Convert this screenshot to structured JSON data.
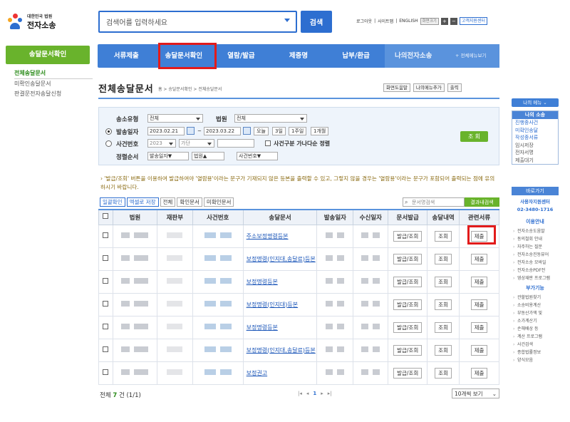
{
  "header": {
    "logo_line1": "대한민국 법원",
    "logo_line2": "전자소송",
    "search_placeholder": "검색어를 입력하세요",
    "search_button": "검색",
    "util": {
      "logout": "로그아웃",
      "sitemap": "사이트맵",
      "english": "ENGLISH",
      "font_size": "화면크기",
      "customer_center": "고객지원센터"
    }
  },
  "gnb": [
    "서류제출",
    "송달문서확인",
    "열람/발급",
    "제증명",
    "납부/환급",
    "나의전자소송",
    "+ 전체메뉴보기"
  ],
  "sidebar": {
    "title": "송달문서확인",
    "items": [
      "전체송달문서",
      "미확인송달문서",
      "판결문전자송달신청"
    ]
  },
  "page": {
    "title": "전체송달문서",
    "breadcrumb": "홈 > 송달문서확인 > 전체송달문서",
    "buttons": [
      "화면도움말",
      "나의메뉴추가",
      "출력"
    ]
  },
  "filter": {
    "send_type_label": "송소유형",
    "send_type_value": "전체",
    "court_label": "법원",
    "court_value": "전체",
    "date_label": "발송일자",
    "date_from": "2023.02.21",
    "date_to": "2023.03.22",
    "date_btns": [
      "오늘",
      "3일",
      "1주일",
      "1개월"
    ],
    "case_label": "사건번호",
    "case_year": "2023",
    "case_kind": "가단",
    "case_multi": "사건구분 가나다순 정렬",
    "sort_label": "정렬순서",
    "sort_values": [
      "발송일자▼",
      "법원▲",
      "사건번호▼"
    ],
    "query_button": "조 회"
  },
  "notice": "› '발급/조회' 버튼을 이용하여 발급하여야 '열람용'이라는 문구가 기재되지 않은 등본을 출력할 수 있고, 그렇지 않을 경우는 '열람용'이라는 문구가 포함되어 출력되는 점에 유의하시기 바랍니다.",
  "actions": [
    "일괄확인",
    "엑셀로 저장",
    "전체",
    "확인문서",
    "미확인문서"
  ],
  "result_search": {
    "placeholder": "문서명검색",
    "button": "결과내검색"
  },
  "table": {
    "headers": [
      "법원",
      "재판부",
      "사건번호",
      "송달문서",
      "발송일자",
      "수신일자",
      "문서발급",
      "송달내역",
      "관련서류"
    ],
    "rows": [
      {
        "doc": "주소보정명령등본",
        "issue": "발급/조회",
        "history": "조회",
        "related": "제출"
      },
      {
        "doc": "보정명령(인지대,송달료)등본",
        "issue": "발급/조회",
        "history": "조회",
        "related": "제출"
      },
      {
        "doc": "보정명령등본",
        "issue": "발급/조회",
        "history": "조회",
        "related": "제출"
      },
      {
        "doc": "보정명령(인지대)등본",
        "issue": "발급/조회",
        "history": "조회",
        "related": "제출"
      },
      {
        "doc": "보정명령등본",
        "issue": "발급/조회",
        "history": "조회",
        "related": "제출"
      },
      {
        "doc": "보정명령(인지대,송달료)등본",
        "issue": "발급/조회",
        "history": "조회",
        "related": "제출"
      },
      {
        "doc": "보정권고",
        "issue": "발급/조회",
        "history": "조회",
        "related": "제출"
      }
    ]
  },
  "footer": {
    "total_prefix": "전체",
    "total_count": "7",
    "total_suffix": "건 (1/1)",
    "page": "1",
    "per_page": "10개씩 보기"
  },
  "right_panel": {
    "my_menu": "나의 메뉴",
    "my_case": "나의 소송",
    "my_case_items": [
      "진행중사건",
      "미확인송달",
      "작성중서류",
      "임시저장",
      "전자서명",
      "제출대기"
    ],
    "shortcut": "바로가기",
    "center": "사용자지원센터",
    "phone": "02-3480-1716",
    "guide": "이용안내",
    "guide_items": [
      "전자소송도움말",
      "동의철회 안내",
      "자주하는 질문",
      "전자소송진동뷰어",
      "전자소송 모바일",
      "전자소송PDF전",
      "영상재판 프로그램"
    ],
    "extra": "부가기능",
    "extra_items": [
      "관할법원찾기",
      "소송비용계산",
      "부동산가액 및",
      "소가계산기",
      "손해배상 등",
      "계산 프로그램",
      "사건검색",
      "종합법률정보",
      "양식모음"
    ]
  },
  "colors": {
    "accent": "#2d6ed0",
    "green": "#69b32c",
    "highlight": "#e21b1b"
  }
}
